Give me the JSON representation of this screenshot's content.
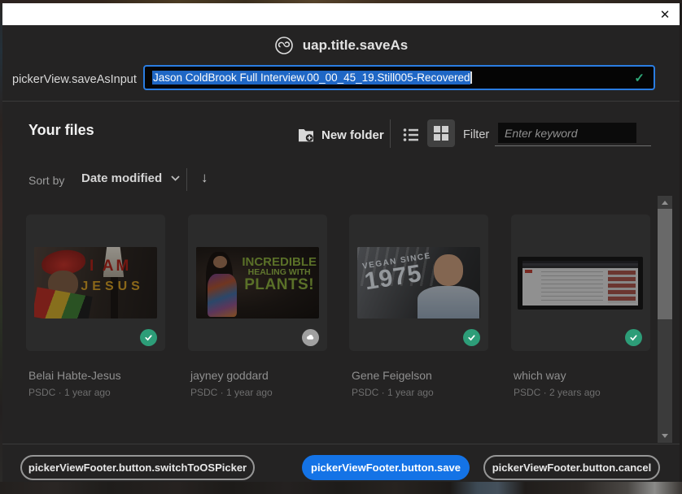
{
  "window": {
    "close_glyph": "✕"
  },
  "dialog": {
    "title": "uap.title.saveAs"
  },
  "save_as": {
    "label": "pickerView.saveAsInput",
    "value": "Jason ColdBrook Full Interview.00_00_45_19.Still005-Recovered",
    "valid_glyph": "✓"
  },
  "toolbar": {
    "section_title": "Your files",
    "new_folder_label": "New folder",
    "filter_label": "Filter",
    "filter_placeholder": "Enter keyword"
  },
  "sort": {
    "label": "Sort by",
    "value": "Date modified",
    "direction_glyph": "↓"
  },
  "files": [
    {
      "name": "Belai Habte-Jesus",
      "meta": "PSDC · 1 year ago",
      "status": "synced",
      "thumb": {
        "line1": "I AM",
        "line2": "JESUS"
      }
    },
    {
      "name": "jayney goddard",
      "meta": "PSDC · 1 year ago",
      "status": "cloud",
      "thumb": {
        "line1": "INCREDIBLE",
        "line2": "HEALING WITH",
        "line3": "PLANTS!"
      }
    },
    {
      "name": "Gene Feigelson",
      "meta": "PSDC · 1 year ago",
      "status": "synced",
      "thumb": {
        "line1": "VEGAN SINCE",
        "line2": "1975"
      }
    },
    {
      "name": "which way",
      "meta": "PSDC · 2 years ago",
      "status": "synced",
      "thumb": {}
    }
  ],
  "footer": {
    "switch_to_os_label": "pickerViewFooter.button.switchToOSPicker",
    "save_label": "pickerViewFooter.button.save",
    "cancel_label": "pickerViewFooter.button.cancel"
  },
  "colors": {
    "accent_blue": "#1473E6",
    "selection_blue": "#1F67C5",
    "success_green": "#2D9D78",
    "cloud_gray": "#A0A0A0"
  }
}
